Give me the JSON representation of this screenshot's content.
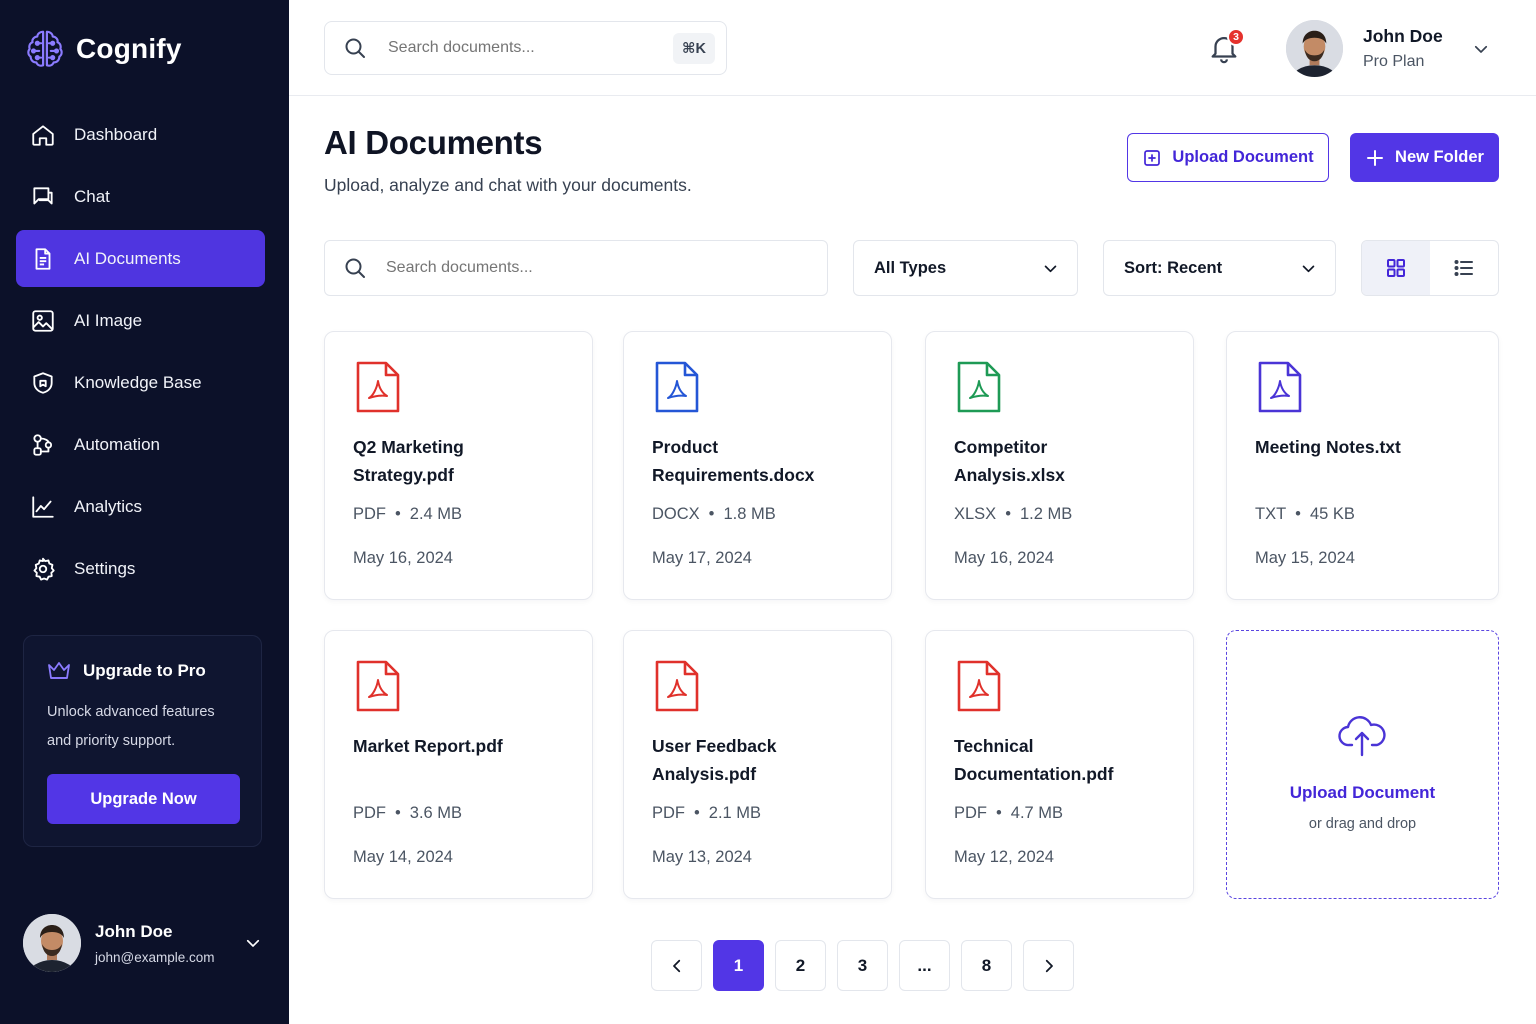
{
  "brand": {
    "name": "Cognify"
  },
  "sidebar": {
    "items": [
      {
        "label": "Dashboard",
        "icon": "home-icon"
      },
      {
        "label": "Chat",
        "icon": "chat-icon"
      },
      {
        "label": "AI Documents",
        "icon": "document-icon",
        "active": true
      },
      {
        "label": "AI Image",
        "icon": "image-icon"
      },
      {
        "label": "Knowledge Base",
        "icon": "shield-icon"
      },
      {
        "label": "Automation",
        "icon": "automation-icon"
      },
      {
        "label": "Analytics",
        "icon": "analytics-icon"
      },
      {
        "label": "Settings",
        "icon": "gear-icon"
      }
    ],
    "upgrade": {
      "title": "Upgrade to Pro",
      "text": "Unlock advanced features and priority support.",
      "button": "Upgrade Now"
    },
    "user": {
      "name": "John Doe",
      "email": "john@example.com"
    }
  },
  "topbar": {
    "search_placeholder": "Search documents...",
    "shortcut": "⌘K",
    "notification_count": "3",
    "user": {
      "name": "John Doe",
      "plan": "Pro Plan"
    }
  },
  "main": {
    "title": "AI Documents",
    "subtitle": "Upload, analyze and chat with your documents.",
    "upload_button": "Upload Document",
    "new_folder_button": "New Folder",
    "filters": {
      "search_placeholder": "Search documents...",
      "type": "All Types",
      "sort": "Sort: Recent",
      "view": "grid"
    },
    "documents": [
      {
        "name": "Q2 Marketing Strategy.pdf",
        "type": "PDF",
        "size": "2.4 MB",
        "date": "May 16, 2024",
        "color": "#e0312b"
      },
      {
        "name": "Product Requirements.docx",
        "type": "DOCX",
        "size": "1.8 MB",
        "date": "May 17, 2024",
        "color": "#2456d6"
      },
      {
        "name": "Competitor Analysis.xlsx",
        "type": "XLSX",
        "size": "1.2 MB",
        "date": "May 16, 2024",
        "color": "#1e9a55"
      },
      {
        "name": "Meeting Notes.txt",
        "type": "TXT",
        "size": "45 KB",
        "date": "May 15, 2024",
        "color": "#4a34d6"
      },
      {
        "name": "Market Report.pdf",
        "type": "PDF",
        "size": "3.6 MB",
        "date": "May 14, 2024",
        "color": "#e0312b"
      },
      {
        "name": "User Feedback Analysis.pdf",
        "type": "PDF",
        "size": "2.1 MB",
        "date": "May 13, 2024",
        "color": "#e0312b"
      },
      {
        "name": "Technical Documentation.pdf",
        "type": "PDF",
        "size": "4.7 MB",
        "date": "May 12, 2024",
        "color": "#e0312b"
      }
    ],
    "upload_card": {
      "title": "Upload Document",
      "subtitle": "or drag and drop"
    },
    "pagination": {
      "pages": [
        "1",
        "2",
        "3",
        "...",
        "8"
      ],
      "current": "1"
    }
  },
  "colors": {
    "accent": "#5236e6",
    "sidebar_bg": "#0c1129",
    "badge": "#e5322d"
  }
}
